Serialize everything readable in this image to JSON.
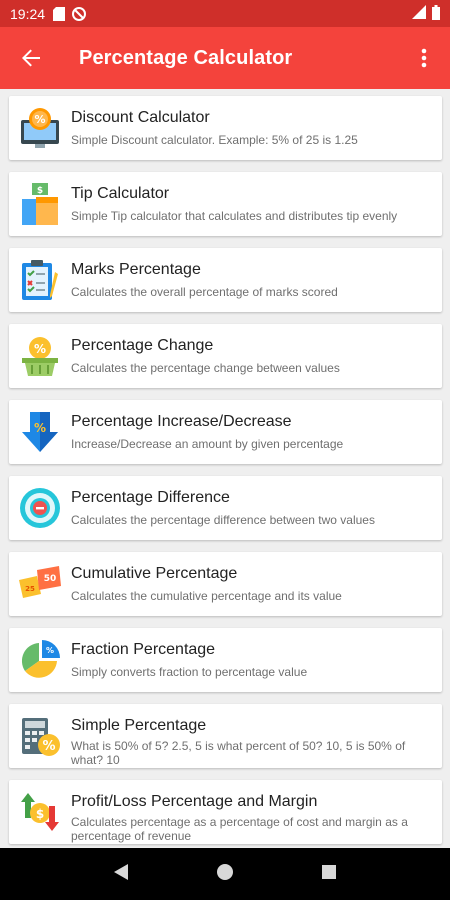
{
  "status_bar": {
    "time": "19:24"
  },
  "app_bar": {
    "title": "Percentage Calculator"
  },
  "items": [
    {
      "title": "Discount Calculator",
      "description": "Simple Discount calculator. Example: 5% of 25 is 1.25"
    },
    {
      "title": "Tip Calculator",
      "description": "Simple Tip calculator that calculates and distributes tip evenly"
    },
    {
      "title": "Marks Percentage",
      "description": "Calculates the overall percentage of marks scored"
    },
    {
      "title": "Percentage Change",
      "description": "Calculates the percentage change between values"
    },
    {
      "title": "Percentage Increase/Decrease",
      "description": "Increase/Decrease an amount by given percentage"
    },
    {
      "title": "Percentage Difference",
      "description": "Calculates the percentage difference between two values"
    },
    {
      "title": "Cumulative Percentage",
      "description": "Calculates the cumulative percentage and its value"
    },
    {
      "title": "Fraction Percentage",
      "description": "Simply converts fraction to percentage value"
    },
    {
      "title": "Simple Percentage",
      "description": "What is 50% of 5? 2.5, 5 is what percent of 50? 10, 5 is 50% of what? 10"
    },
    {
      "title": "Profit/Loss Percentage and Margin",
      "description": "Calculates percentage as a percentage of cost and margin as a percentage of revenue"
    }
  ],
  "colors": {
    "status_bar": "#cf2f2a",
    "app_bar": "#f4433c",
    "background": "#efefef"
  }
}
